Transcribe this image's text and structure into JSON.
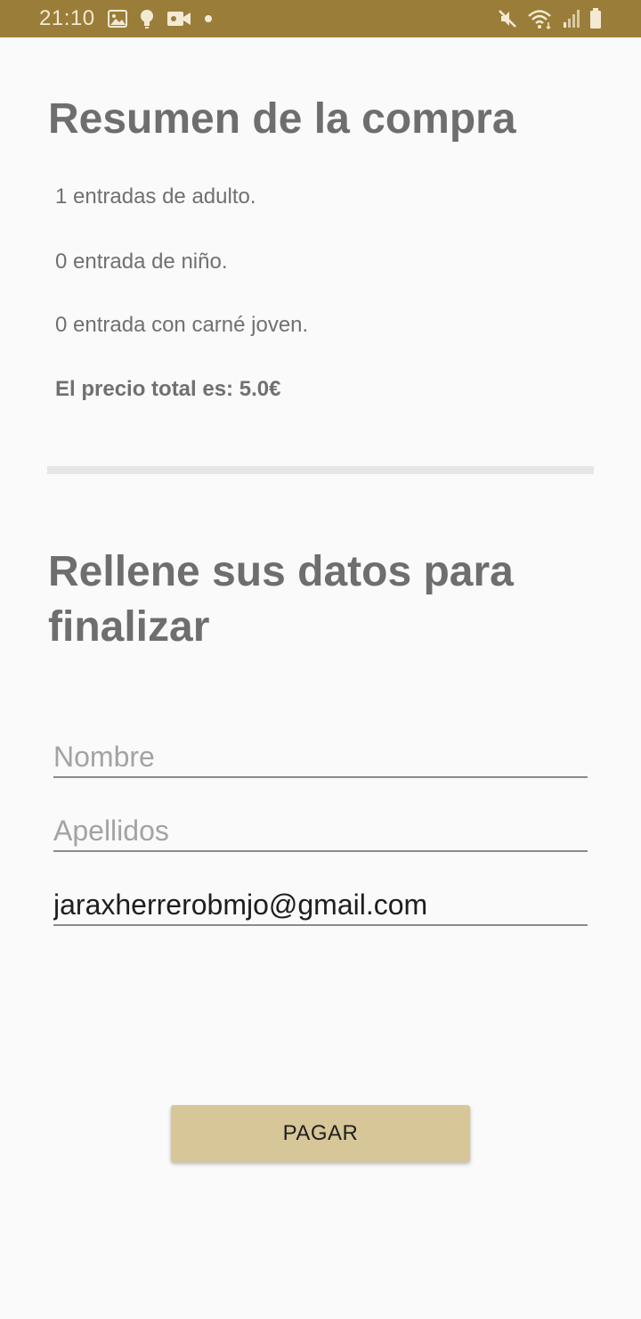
{
  "status_bar": {
    "time": "21:10",
    "left_icons": [
      "image-icon",
      "bulb-icon",
      "video-icon",
      "dot-icon"
    ],
    "right_icons": [
      "mute-icon",
      "wifi-icon",
      "signal-icon",
      "battery-icon"
    ],
    "background": "#9a7d38"
  },
  "summary": {
    "title": "Resumen de la compra",
    "adult_tickets": "1 entradas de adulto.",
    "child_tickets": "0 entrada de niño.",
    "youth_card_tickets": "0 entrada con carné joven.",
    "total_price": "El precio total es: 5.0€"
  },
  "form": {
    "title": "Rellene sus datos para finalizar",
    "name": {
      "placeholder": "Nombre",
      "value": ""
    },
    "surname": {
      "placeholder": "Apellidos",
      "value": ""
    },
    "email": {
      "placeholder": "",
      "value": "jaraxherrerobmjo@gmail.com"
    }
  },
  "pay_button": {
    "label": "PAGAR",
    "color": "#d7c697"
  }
}
